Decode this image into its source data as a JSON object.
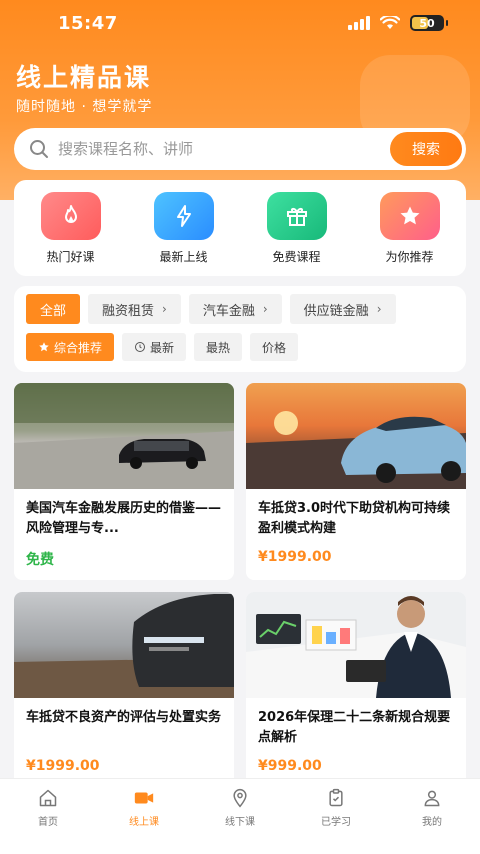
{
  "status_bar": {
    "time": "15:47",
    "battery": "50"
  },
  "header": {
    "title": "线上精品课",
    "subtitle": "随时随地 · 想学就学"
  },
  "search": {
    "placeholder": "搜索课程名称、讲师",
    "button_label": "搜索"
  },
  "quick_entries": [
    {
      "label": "热门好课",
      "icon": "flame-icon",
      "color": "#ff6b6b"
    },
    {
      "label": "最新上线",
      "icon": "lightning-icon",
      "color": "#2ea5ff"
    },
    {
      "label": "免费课程",
      "icon": "gift-icon",
      "color": "#22c98a"
    },
    {
      "label": "为你推荐",
      "icon": "star-icon",
      "color": "#ff6a8a"
    }
  ],
  "categories": [
    {
      "label": "全部",
      "active": true
    },
    {
      "label": "融资租赁"
    },
    {
      "label": "汽车金融"
    },
    {
      "label": "供应链金融"
    }
  ],
  "sort_options": [
    {
      "label": "综合推荐",
      "icon": "star-icon",
      "active": true
    },
    {
      "label": "最新",
      "icon": "clock-icon"
    },
    {
      "label": "最热"
    },
    {
      "label": "价格"
    }
  ],
  "courses": [
    {
      "title": "美国汽车金融发展历史的借鉴——风险管理与专...",
      "price": "免费",
      "image": "black-sedan-road"
    },
    {
      "title": "车抵贷3.0时代下助贷机构可持续盈利模式构建",
      "price": "¥1999.00",
      "image": "blue-sports-car-sunset"
    },
    {
      "title": "车抵贷不良资产的评估与处置实务",
      "price": "¥1999.00",
      "image": "dark-suv-headlight"
    },
    {
      "title": "2026年保理二十二条新规合规要点解析",
      "price": "¥999.00",
      "image": "businessman-with-charts"
    }
  ],
  "tabbar": [
    {
      "label": "首页",
      "icon": "home-icon"
    },
    {
      "label": "线上课",
      "icon": "video-icon",
      "active": true
    },
    {
      "label": "线下课",
      "icon": "location-icon"
    },
    {
      "label": "已学习",
      "icon": "clipboard-icon"
    },
    {
      "label": "我的",
      "icon": "user-icon"
    }
  ],
  "colors": {
    "accent": "#ff8a1e",
    "free": "#2fb54a"
  }
}
